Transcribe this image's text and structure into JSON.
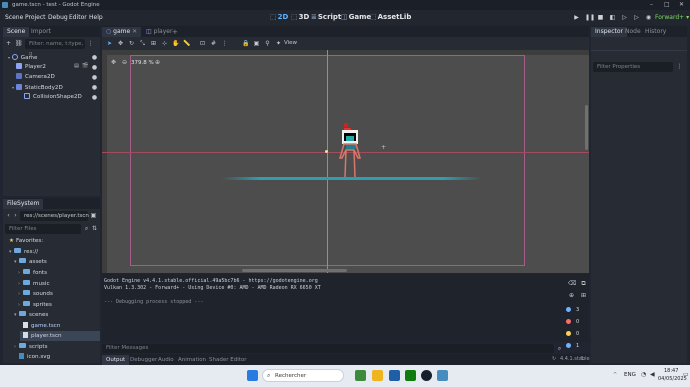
{
  "window": {
    "title": "game.tscn - test - Godot Engine"
  },
  "menu": [
    "Scene",
    "Project",
    "Debug",
    "Editor",
    "Help"
  ],
  "workspaces": [
    {
      "label": "2D",
      "icon": "2d-icon",
      "active": true
    },
    {
      "label": "3D",
      "icon": "3d-icon",
      "active": false
    },
    {
      "label": "Script",
      "icon": "script-icon",
      "active": false
    },
    {
      "label": "Game",
      "icon": "game-icon",
      "active": false
    },
    {
      "label": "AssetLib",
      "icon": "assetlib-icon",
      "active": false
    }
  ],
  "renderer": "Forward+",
  "scene_dock": {
    "tabs": [
      "Scene",
      "Import"
    ],
    "filter_placeholder": "Filter: name, t:type, g",
    "nodes": [
      {
        "label": "Game",
        "depth": 0,
        "icon": "node2d-icon",
        "color": "#8da5f3"
      },
      {
        "label": "Player2",
        "depth": 1,
        "icon": "scene-instance-icon",
        "color": "#8da5f3"
      },
      {
        "label": "Camera2D",
        "depth": 1,
        "icon": "camera2d-icon",
        "color": "#8da5f3"
      },
      {
        "label": "StaticBody2D",
        "depth": 1,
        "icon": "staticbody2d-icon",
        "color": "#8da5f3"
      },
      {
        "label": "CollisionShape2D",
        "depth": 2,
        "icon": "collisionshape2d-icon",
        "color": "#8da5f3"
      }
    ]
  },
  "filesystem": {
    "title": "FileSystem",
    "path": "res://scenes/player.tscn",
    "filter_placeholder": "Filter Files",
    "favorites_label": "Favorites:",
    "items": [
      {
        "label": "res://",
        "depth": 0,
        "type": "folder",
        "expanded": true
      },
      {
        "label": "assets",
        "depth": 1,
        "type": "folder",
        "expanded": true
      },
      {
        "label": "fonts",
        "depth": 2,
        "type": "folder",
        "expanded": false
      },
      {
        "label": "music",
        "depth": 2,
        "type": "folder",
        "expanded": false
      },
      {
        "label": "sounds",
        "depth": 2,
        "type": "folder",
        "expanded": false
      },
      {
        "label": "sprites",
        "depth": 2,
        "type": "folder",
        "expanded": false
      },
      {
        "label": "scenes",
        "depth": 1,
        "type": "folder",
        "expanded": true
      },
      {
        "label": "game.tscn",
        "depth": 2,
        "type": "file",
        "selected": false
      },
      {
        "label": "player.tscn",
        "depth": 2,
        "type": "file",
        "selected": true
      },
      {
        "label": "scripts",
        "depth": 1,
        "type": "folder",
        "expanded": false
      },
      {
        "label": "icon.svg",
        "depth": 1,
        "type": "file",
        "selected": false
      }
    ]
  },
  "editor_tabs": [
    {
      "label": "game",
      "active": true
    },
    {
      "label": "player",
      "active": false
    }
  ],
  "viewport": {
    "zoom": "379.8 %",
    "view_label": "View"
  },
  "output": {
    "lines": [
      "Godot Engine v4.4.1.stable.official.49a5bc7b6 - https://godotengine.org",
      "Vulkan 1.3.302 - Forward+ - Using Device #0: AMD - AMD Radeon RX 6650 XT",
      "",
      "--- Debugging process stopped ---"
    ],
    "filter_placeholder": "Filter Messages",
    "counts": [
      {
        "label": "3",
        "color": "#6fb3ff"
      },
      {
        "label": "0",
        "color": "#ff6b6b"
      },
      {
        "label": "0",
        "color": "#ffcf5c"
      },
      {
        "label": "1",
        "color": "#6fb3ff"
      }
    ],
    "version": "4.4.1.stable"
  },
  "bottom_tabs": [
    "Output",
    "Debugger",
    "Audio",
    "Animation",
    "Shader Editor"
  ],
  "inspector": {
    "tabs": [
      "Inspector",
      "Node",
      "History"
    ],
    "filter_placeholder": "Filter Properties"
  },
  "taskbar": {
    "search_placeholder": "Rechercher",
    "lang": "ENG",
    "time": "18:47",
    "date": "04/05/2025"
  }
}
